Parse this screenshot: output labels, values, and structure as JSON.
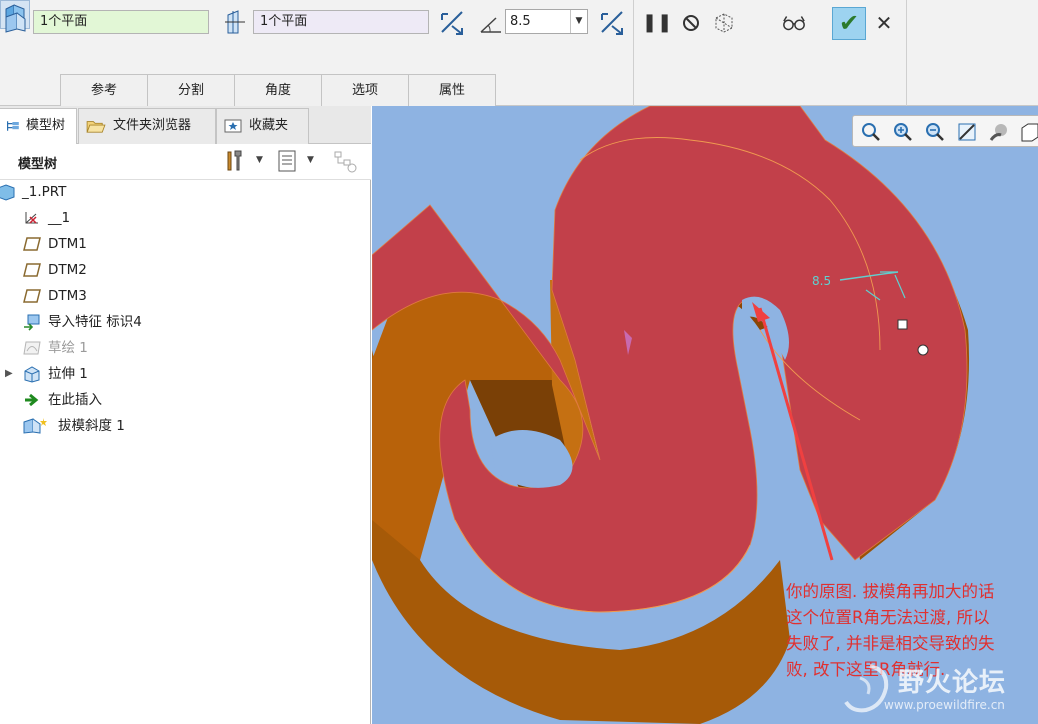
{
  "dashboard": {
    "ref1_value": "1个平面",
    "ref2_value": "1个平面",
    "angle_value": "8.5",
    "tabs": [
      "参考",
      "分割",
      "角度",
      "选项",
      "属性"
    ]
  },
  "panel": {
    "tabs": [
      {
        "label": "模型树",
        "icon": "model-tree-icon"
      },
      {
        "label": "文件夹浏览器",
        "icon": "folder-browser-icon"
      },
      {
        "label": "收藏夹",
        "icon": "favorites-icon"
      }
    ],
    "header_title": "模型树",
    "tree": [
      {
        "label": "_1.PRT",
        "icon": "part-icon",
        "dim": false
      },
      {
        "label": "__1",
        "icon": "csys-icon",
        "dim": false
      },
      {
        "label": "DTM1",
        "icon": "datum-plane-icon",
        "dim": false
      },
      {
        "label": "DTM2",
        "icon": "datum-plane-icon",
        "dim": false
      },
      {
        "label": "DTM3",
        "icon": "datum-plane-icon",
        "dim": false
      },
      {
        "label": "导入特征 标识4",
        "icon": "import-feature-icon",
        "dim": false
      },
      {
        "label": "草绘 1",
        "icon": "sketch-icon",
        "dim": true
      },
      {
        "label": "拉伸 1",
        "icon": "extrude-icon",
        "dim": false
      },
      {
        "label": "在此插入",
        "icon": "insert-here-icon",
        "dim": false
      },
      {
        "label": "拔模斜度 1",
        "icon": "draft-icon",
        "dim": false
      }
    ]
  },
  "viewport": {
    "dimension_label": "8.5",
    "annotation": [
      "你的原图. 拔模角再加大的话",
      "这个位置R角无法过渡, 所以",
      "失败了, 并非是相交导致的失",
      "败, 改下这里R角就行."
    ],
    "watermark_title": "野火论坛",
    "watermark_url": "www.proewildfire.cn"
  },
  "colors": {
    "model_face": "#c0404a",
    "model_side": "#b8620a",
    "background": "#8eb3e2",
    "annotation": "#e03030"
  }
}
